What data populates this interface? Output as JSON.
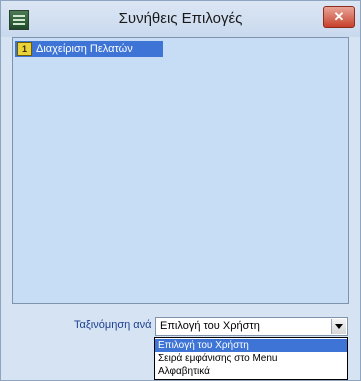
{
  "window": {
    "title": "Συνήθεις Επιλογές",
    "close_label": "✕"
  },
  "list": {
    "items": [
      {
        "label": "Διαχείριση Πελατών",
        "icon": "star-icon",
        "badge": "1",
        "selected": true
      }
    ]
  },
  "sort": {
    "label": "Ταξινόμηση ανά",
    "selected": "Επιλογή του Χρήστη",
    "options": [
      "Επιλογή του Χρήστη",
      "Σειρά εμφάνισης στο Menu",
      "Αλφαβητικά"
    ]
  },
  "colors": {
    "selection": "#3d74d6",
    "panel": "#c7dcf5",
    "window": "#d6e3f2",
    "close": "#c7412b"
  }
}
